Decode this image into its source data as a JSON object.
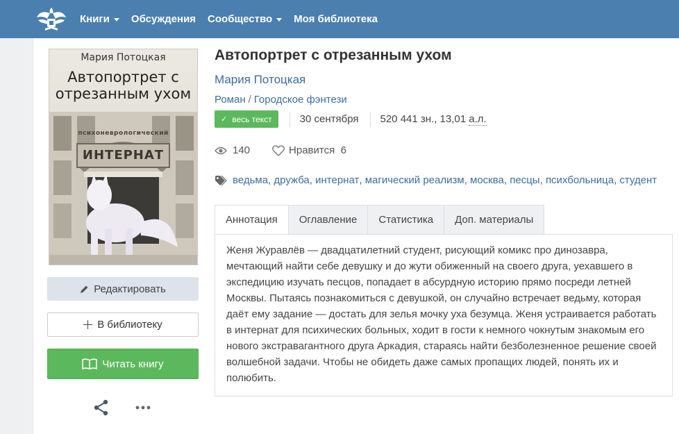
{
  "nav": {
    "items": [
      {
        "label": "Книги",
        "dropdown": true
      },
      {
        "label": "Обсуждения",
        "dropdown": false
      },
      {
        "label": "Сообщество",
        "dropdown": true
      },
      {
        "label": "Моя библиотека",
        "dropdown": false
      }
    ]
  },
  "cover": {
    "author": "Мария Потоцкая",
    "title_line1": "Автопортрет с",
    "title_line2": "отрезанным ухом",
    "arch_text": "психоневрологический",
    "sign": "ИНТЕРНАТ"
  },
  "actions": {
    "edit": "Редактировать",
    "add_library": "В библиотеку",
    "read": "Читать книгу"
  },
  "book": {
    "title": "Автопортрет с отрезанным ухом",
    "author": "Мария Потоцкая",
    "genre1": "Роман",
    "genre_sep": "/",
    "genre2": "Городское фэнтези",
    "badge": "весь текст",
    "date": "30 сентября",
    "size_chars": "520 441 зн., 13,01",
    "size_unit": "а.л.",
    "views": "140",
    "likes_label": "Нравится",
    "likes_count": "6"
  },
  "tags": [
    "ведьма",
    "дружба",
    "интернат",
    "магический реализм",
    "москва",
    "песцы",
    "психбольница",
    "студент"
  ],
  "tabs": [
    "Аннотация",
    "Оглавление",
    "Статистика",
    "Доп. материалы"
  ],
  "annotation": "Женя Журавлёв — двадцатилетний студент, рисующий комикс про динозавра, мечтающий найти себе девушку и до жути обиженный на своего друга, уехавшего в экспедицию изучать песцов, попадает в абсурдную историю прямо посреди летней Москвы. Пытаясь познакомиться с девушкой, он случайно встречает ведьму, которая даёт ему задание — достать для зелья мочку уха безумца. Женя устраивается работать в интернат для психических больных, ходит в гости к немного чокнутым знакомым его нового экстравагантного друга Аркадия, стараясь найти безболезненное решение своей волшебной задачи. Чтобы не обидеть даже самых пропащих людей, понять их и полюбить.",
  "colors": {
    "nav_bg": "#4a7fb0",
    "link": "#3e6d9c",
    "success": "#5cb85c"
  },
  "icons": [
    "logo-icon",
    "pencil-icon",
    "plus-icon",
    "book-icon",
    "share-icon",
    "more-icon",
    "eye-icon",
    "heart-icon",
    "tag-icon",
    "check-icon"
  ]
}
